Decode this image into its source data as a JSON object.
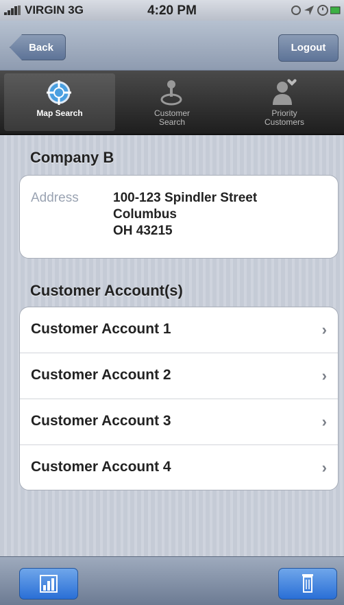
{
  "status_bar": {
    "carrier": "VIRGIN 3G",
    "time": "4:20 PM"
  },
  "nav": {
    "back_label": "Back",
    "logout_label": "Logout"
  },
  "tabs": [
    {
      "label": "Map Search",
      "icon": "crosshair-icon",
      "active": true
    },
    {
      "label_line1": "Customer",
      "label_line2": "Search",
      "icon": "joystick-icon"
    },
    {
      "label_line1": "Priority",
      "label_line2": "Customers",
      "icon": "person-heart-icon"
    }
  ],
  "company": {
    "name": "Company B",
    "address_label": "Address",
    "address_line1": "100-123 Spindler Street",
    "address_line2": "Columbus",
    "address_line3": "OH 43215"
  },
  "accounts": {
    "title": "Customer Account(s)",
    "items": [
      {
        "label": "Customer Account 1"
      },
      {
        "label": "Customer Account 2"
      },
      {
        "label": "Customer Account 3"
      },
      {
        "label": "Customer Account 4"
      }
    ]
  },
  "toolbar": {
    "left_icon": "bar-chart-icon",
    "right_icon": "trash-icon"
  }
}
